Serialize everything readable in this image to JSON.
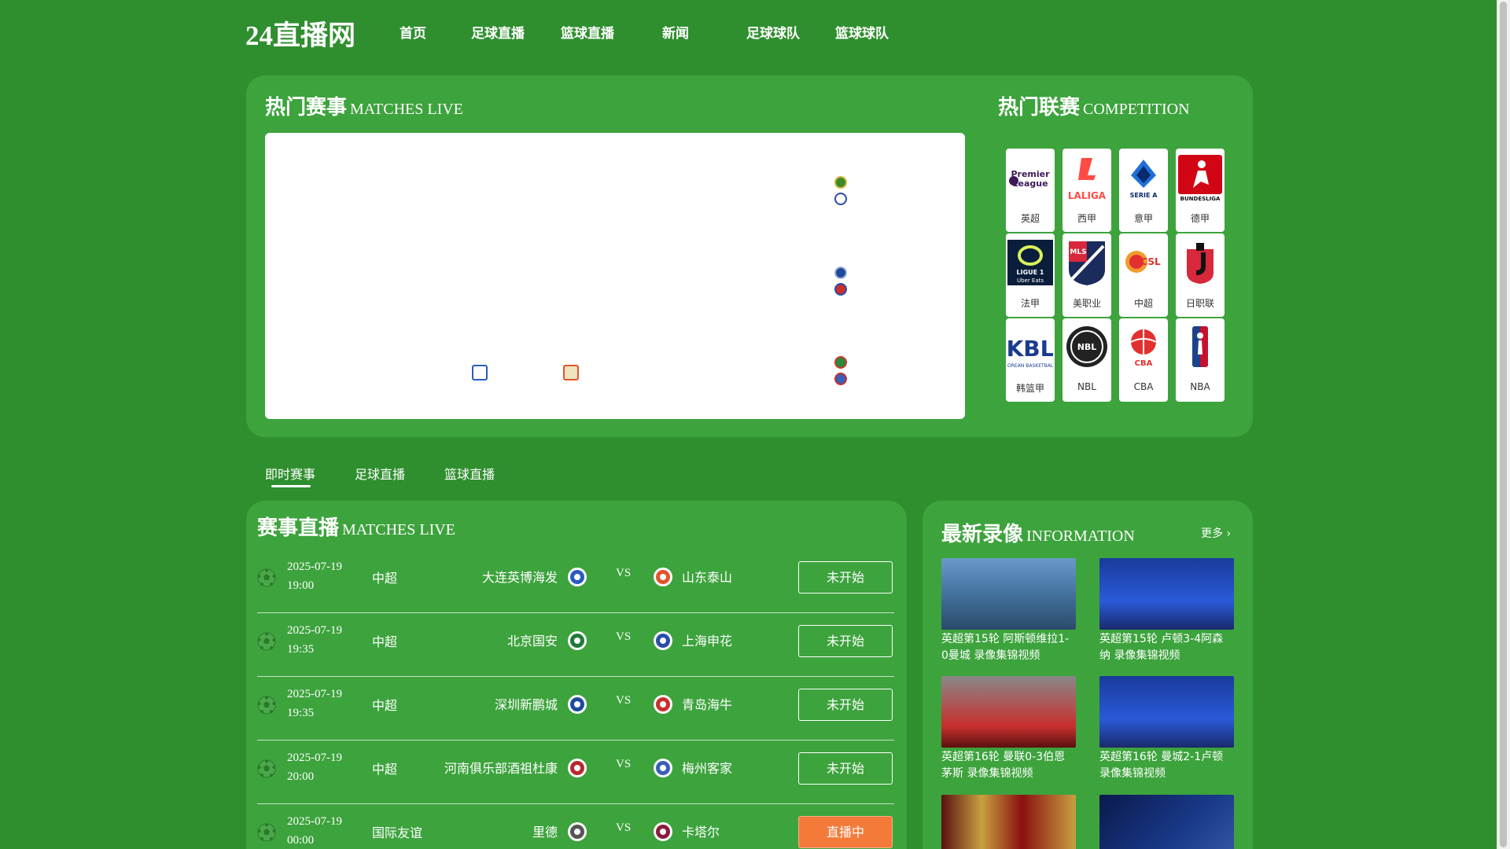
{
  "site": {
    "logo": "24直播网"
  },
  "nav": {
    "items": [
      "首页",
      "足球直播",
      "篮球直播",
      "新闻",
      "足球球队",
      "篮球球队"
    ]
  },
  "hero": {
    "title": "热门赛事",
    "title_en": "MATCHES LIVE"
  },
  "competitions": {
    "title": "热门联赛",
    "title_en": "COMPETITION",
    "items": [
      {
        "label": "英超",
        "icon": "premier-league-logo"
      },
      {
        "label": "西甲",
        "icon": "laliga-logo"
      },
      {
        "label": "意甲",
        "icon": "serie-a-logo"
      },
      {
        "label": "德甲",
        "icon": "bundesliga-logo"
      },
      {
        "label": "法甲",
        "icon": "ligue1-logo"
      },
      {
        "label": "美职业",
        "icon": "mls-logo"
      },
      {
        "label": "中超",
        "icon": "csl-logo"
      },
      {
        "label": "日职联",
        "icon": "jleague-logo"
      },
      {
        "label": "韩篮甲",
        "icon": "kbl-logo"
      },
      {
        "label": "NBL",
        "icon": "nbl-logo"
      },
      {
        "label": "CBA",
        "icon": "cba-logo"
      },
      {
        "label": "NBA",
        "icon": "nba-logo"
      }
    ]
  },
  "tabs": {
    "items": [
      "即时赛事",
      "足球直播",
      "篮球直播"
    ],
    "active": 0
  },
  "matches": {
    "title": "赛事直播",
    "title_en": "MATCHES LIVE",
    "vs": "VS",
    "rows": [
      {
        "date": "2025-07-19",
        "time": "19:00",
        "league": "中超",
        "home": "大连英博海发",
        "away": "山东泰山",
        "status": "未开始",
        "live": false,
        "home_color": "#2a5cbf",
        "away_color": "#e2542b"
      },
      {
        "date": "2025-07-19",
        "time": "19:35",
        "league": "中超",
        "home": "北京国安",
        "away": "上海申花",
        "status": "未开始",
        "live": false,
        "home_color": "#1f7a3a",
        "away_color": "#2a4da8"
      },
      {
        "date": "2025-07-19",
        "time": "19:35",
        "league": "中超",
        "home": "深圳新鹏城",
        "away": "青岛海牛",
        "status": "未开始",
        "live": false,
        "home_color": "#1e4b9c",
        "away_color": "#c8302e"
      },
      {
        "date": "2025-07-19",
        "time": "20:00",
        "league": "中超",
        "home": "河南俱乐部酒祖杜康",
        "away": "梅州客家",
        "status": "未开始",
        "live": false,
        "home_color": "#b8282e",
        "away_color": "#3a5fb8"
      },
      {
        "date": "2025-07-19",
        "time": "00:00",
        "league": "国际友谊",
        "home": "里德",
        "away": "卡塔尔",
        "status": "直播中",
        "live": true,
        "home_color": "#555555",
        "away_color": "#8a1c3c"
      }
    ]
  },
  "replays": {
    "title": "最新录像",
    "title_en": "INFORMATION",
    "more": "更多",
    "items": [
      {
        "title": "英超第15轮 阿斯顿维拉1-0曼城 录像集锦视频",
        "icon": "man-city-player-thumbnail"
      },
      {
        "title": "英超第15轮 卢顿3-4阿森纳 录像集锦视频",
        "icon": "torres-chelsea-thumbnail"
      },
      {
        "title": "英超第16轮 曼联0-3伯恩茅斯 录像集锦视频",
        "icon": "bayern-player-thumbnail"
      },
      {
        "title": "英超第16轮 曼城2-1卢顿 录像集锦视频",
        "icon": "torres-chelsea-thumbnail"
      },
      {
        "title": "",
        "icon": "fighters-thumbnail"
      },
      {
        "title": "",
        "icon": "vardy-thumbnail"
      }
    ]
  }
}
